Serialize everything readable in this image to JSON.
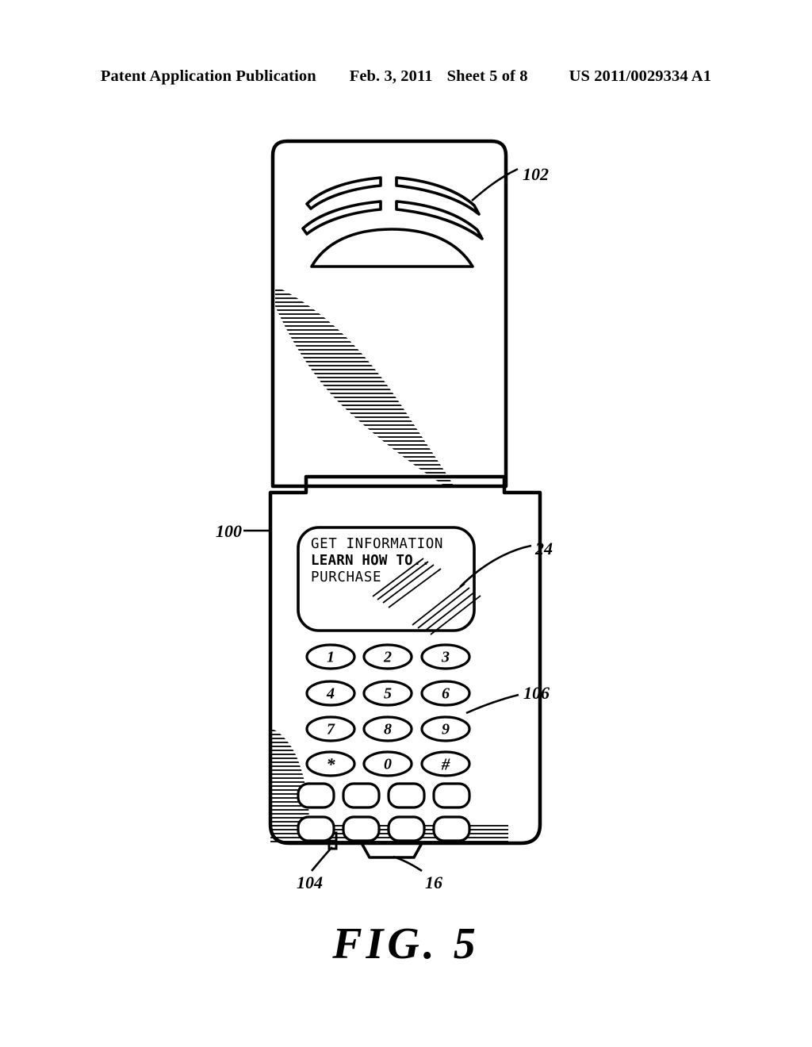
{
  "header": {
    "publication": "Patent Application Publication",
    "date": "Feb. 3, 2011",
    "sheet": "Sheet 5 of 8",
    "patent_number": "US 2011/0029334 A1"
  },
  "figure": {
    "caption": "FIG. 5",
    "subject": "flip mobile phone",
    "line_color": "#000000",
    "background_color": "#ffffff"
  },
  "device": {
    "display_screen": {
      "lines": [
        {
          "text": "GET INFORMATION",
          "selected": false
        },
        {
          "text": "LEARN HOW TO..",
          "selected": true
        },
        {
          "text": "PURCHASE",
          "selected": false
        }
      ]
    },
    "keypad": {
      "rows": [
        [
          "1",
          "2",
          "3"
        ],
        [
          "4",
          "5",
          "6"
        ],
        [
          "7",
          "8",
          "9"
        ],
        [
          "*",
          "0",
          "#"
        ]
      ]
    },
    "soft_keys": {
      "rows": 2,
      "columns": 4,
      "labels": [
        "",
        "",
        "",
        "",
        "",
        "",
        "",
        ""
      ]
    },
    "speaker_grille": {
      "slot_rows": 2,
      "solid_arc": true
    }
  },
  "reference_numerals": [
    {
      "id": "102",
      "label": "102",
      "points_to": "speaker-grille"
    },
    {
      "id": "100",
      "label": "100",
      "points_to": "phone-body"
    },
    {
      "id": "24",
      "label": "24",
      "points_to": "selected-menu-item-highlight"
    },
    {
      "id": "106",
      "label": "106",
      "points_to": "keypad"
    },
    {
      "id": "104",
      "label": "104",
      "points_to": "microphone-nub"
    },
    {
      "id": "16",
      "label": "16",
      "points_to": "bottom-connector"
    }
  ]
}
